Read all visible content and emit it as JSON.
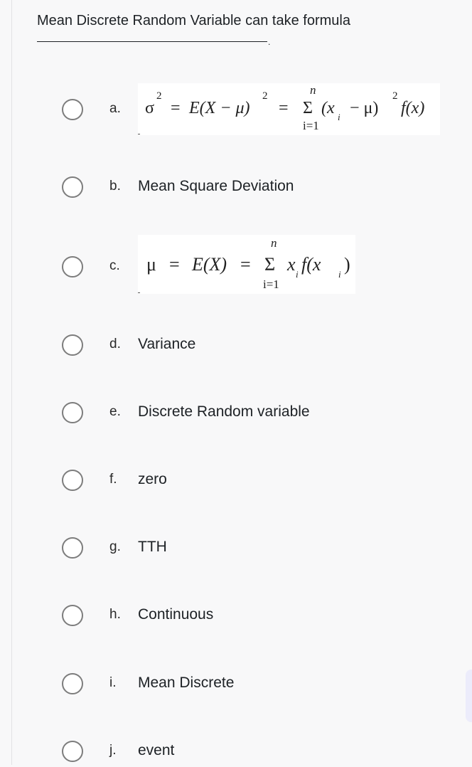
{
  "question": {
    "text": "Mean Discrete Random Variable can take formula",
    "blank_suffix": "."
  },
  "options": [
    {
      "letter": "a.",
      "type": "formula",
      "formula_text": "σ² = E(X − μ)² = Σ_{i=1}^{n} (x_i − μ)² f(x)",
      "parts": {
        "sigma": "σ",
        "sup2": "2",
        "eq1": "=",
        "E": "E(X − μ)",
        "eq2": "=",
        "sum": "Σ",
        "n": "n",
        "i1": "i=1",
        "term": "(x",
        "sub_i": "i",
        "minus": "− μ)",
        "sup2b": "2",
        "fx": "f(x)"
      }
    },
    {
      "letter": "b.",
      "type": "text",
      "text": "Mean Square Deviation"
    },
    {
      "letter": "c.",
      "type": "formula",
      "formula_text": "μ = E(X) = Σ_{i=1}^{n} x_i f(x_i)",
      "parts": {
        "mu": "μ",
        "eq1": "=",
        "E": "E(X)",
        "eq2": "=",
        "sum": "Σ",
        "n": "n",
        "i1": "i=1",
        "x": "x",
        "sub_i": "i",
        "f": "f(x",
        "sub_i2": "i",
        "close": ")"
      }
    },
    {
      "letter": "d.",
      "type": "text",
      "text": "Variance"
    },
    {
      "letter": "e.",
      "type": "text",
      "text": "Discrete Random variable"
    },
    {
      "letter": "f.",
      "type": "text",
      "text": "zero"
    },
    {
      "letter": "g.",
      "type": "text",
      "text": "TTH"
    },
    {
      "letter": "h.",
      "type": "text",
      "text": "Continuous"
    },
    {
      "letter": "i.",
      "type": "text",
      "text": "Mean Discrete"
    },
    {
      "letter": "j.",
      "type": "text",
      "text": "event"
    }
  ],
  "colors": {
    "background": "#f8f8f9",
    "text": "#1d2125",
    "radio_border": "#7d7d7d",
    "scroll_tab": "#ececfb"
  }
}
